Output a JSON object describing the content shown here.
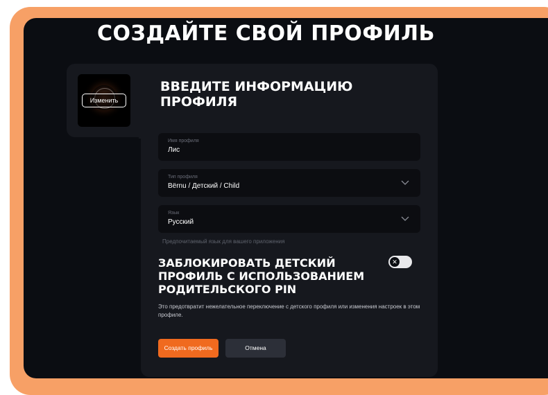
{
  "page": {
    "title": "СОЗДАЙТЕ СВОЙ ПРОФИЛЬ"
  },
  "avatar": {
    "change_label": "Изменить"
  },
  "form": {
    "title": "ВВЕДИТЕ ИНФОРМАЦИЮ ПРОФИЛЯ",
    "fields": [
      {
        "label": "Имя профиля",
        "value": "Лис"
      },
      {
        "label": "Тип профиля",
        "value": "Bërnu / Детский / Child",
        "icon": "chevron-down-icon"
      },
      {
        "label": "Язык",
        "value": "Русский",
        "icon": "chevron-down-icon"
      }
    ],
    "language_hint": "Предпочитаемый язык для вашего приложения"
  },
  "lock": {
    "title": "ЗАБЛОКИРОВАТЬ ДЕТСКИЙ ПРОФИЛЬ С ИСПОЛЬЗОВАНИЕМ РОДИТЕЛЬСКОГО PIN",
    "description": "Это предотвратит нежелательное переключение с детского профиля или изменения настроек в этом профиле.",
    "toggle_icon": "close-icon",
    "enabled": false
  },
  "actions": {
    "create_label": "Создать профиль",
    "cancel_label": "Отмена"
  },
  "colors": {
    "frame": "#f7a066",
    "background": "#0b0d12",
    "panel": "#16181e",
    "accent": "#f06a1f"
  }
}
